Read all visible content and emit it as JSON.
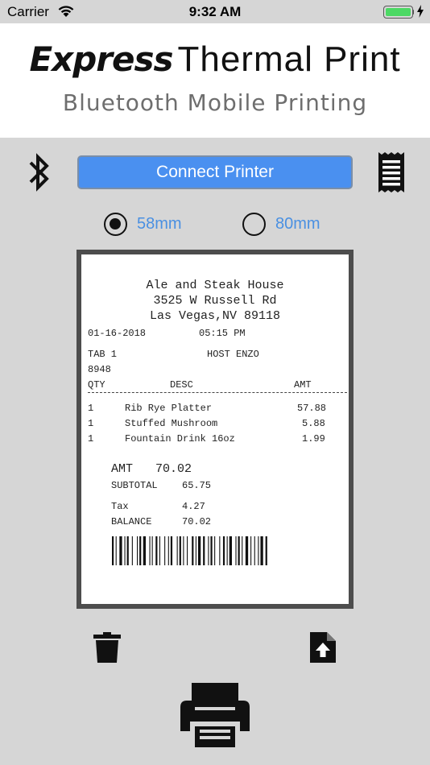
{
  "status_bar": {
    "carrier": "Carrier",
    "time": "9:32 AM"
  },
  "header": {
    "brand_bold": "Express",
    "brand_light": "Thermal Print",
    "subtitle": "Bluetooth Mobile Printing"
  },
  "toolbar": {
    "connect_label": "Connect Printer",
    "bluetooth_icon": "bluetooth-icon",
    "receipt_icon": "receipt-icon"
  },
  "paper_size": {
    "options": [
      "58mm",
      "80mm"
    ],
    "selected": "58mm"
  },
  "receipt": {
    "store_name": "Ale and Steak House",
    "address1": "3525 W Russell Rd",
    "address2": "Las Vegas,NV 89118",
    "date": "01-16-2018",
    "time": "05:15 PM",
    "tab": "TAB 1",
    "host": "HOST ENZO",
    "ticket": "8948",
    "col_qty": "QTY",
    "col_desc": "DESC",
    "col_amt": "AMT",
    "items": [
      {
        "qty": "1",
        "desc": "Rib Rye Platter",
        "amt": "57.88"
      },
      {
        "qty": "1",
        "desc": "Stuffed Mushroom",
        "amt": "5.88"
      },
      {
        "qty": "1",
        "desc": "Fountain Drink 16oz",
        "amt": "1.99"
      }
    ],
    "amt_label": "AMT",
    "amt_value": "70.02",
    "subtotal_label": "SUBTOTAL",
    "subtotal_value": "65.75",
    "tax_label": "Tax",
    "tax_value": "4.27",
    "balance_label": "BALANCE",
    "balance_value": "70.02"
  },
  "actions": {
    "delete_icon": "trash-icon",
    "upload_icon": "file-upload-icon",
    "print_icon": "printer-icon"
  },
  "colors": {
    "accent": "#4a90f0",
    "radio_label": "#4a90e2",
    "background": "#d6d6d6",
    "battery": "#4cd964"
  }
}
